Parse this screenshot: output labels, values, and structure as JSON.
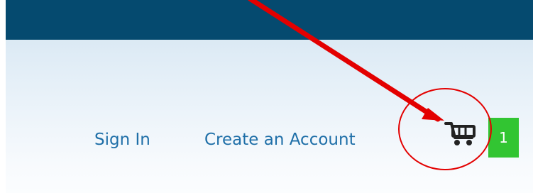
{
  "header": {
    "top_bar_color": "#054a6f",
    "links": {
      "sign_in": "Sign In",
      "create_account": "Create an Account"
    },
    "cart": {
      "icon": "shopping-cart-icon",
      "count": "1",
      "badge_color": "#32c532"
    }
  },
  "annotation": {
    "color": "#e30000",
    "shapes": [
      "arrow",
      "ellipse"
    ]
  }
}
